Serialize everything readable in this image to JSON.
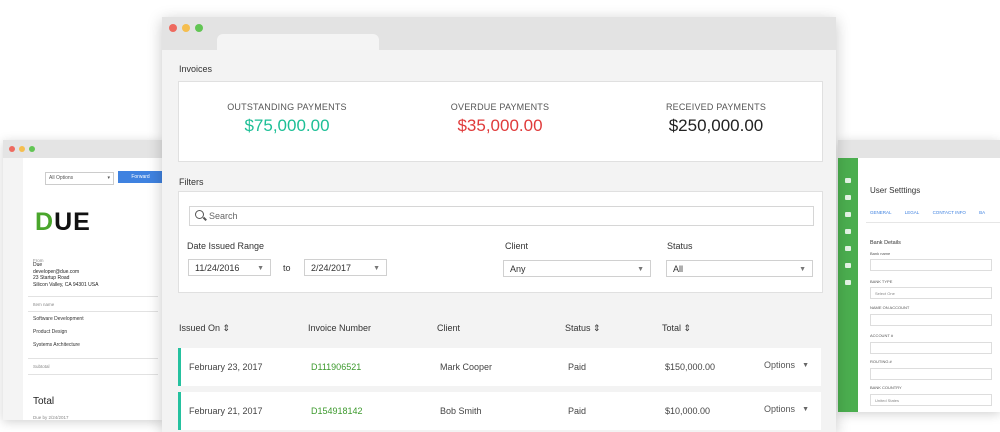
{
  "left_window": {
    "select_value": "All Options",
    "button_label": "Forward",
    "logo_text": "DUE",
    "from_label": "From",
    "company": "Due",
    "email": "developer@due.com",
    "street": "23 Startup Road",
    "city": "Silicon Valley, CA 94301 USA",
    "items_header": "Item name",
    "items": [
      "Software Development",
      "Product Design",
      "Systems Architecture"
    ],
    "subtotal_label": "Subtotal",
    "total_label": "Total",
    "due_label": "Due by 2/24/2017"
  },
  "right_window": {
    "title": "User Setttings",
    "tabs": [
      "GENERAL",
      "LEGAL",
      "CONTACT INFO",
      "BA"
    ],
    "section": "Bank Details",
    "fields": [
      {
        "label": "Bank name",
        "value": ""
      },
      {
        "label": "BANK TYPE",
        "value": "Select One"
      },
      {
        "label": "NAME ON ACCOUNT",
        "value": ""
      },
      {
        "label": "ACCOUNT #",
        "value": ""
      },
      {
        "label": "ROUTING #",
        "value": ""
      },
      {
        "label": "BANK COUNTRY",
        "value": "United States"
      }
    ]
  },
  "main": {
    "invoices_label": "Invoices",
    "summary": [
      {
        "label": "OUTSTANDING PAYMENTS",
        "value": "$75,000.00",
        "color": "#1dbf96"
      },
      {
        "label": "OVERDUE PAYMENTS",
        "value": "$35,000.00",
        "color": "#e03b3b"
      },
      {
        "label": "RECEIVED PAYMENTS",
        "value": "$250,000.00",
        "color": "#222222"
      }
    ],
    "filters_label": "Filters",
    "search_placeholder": "Search",
    "date_range_label": "Date Issued Range",
    "date_from": "11/24/2016",
    "to_label": "to",
    "date_to": "2/24/2017",
    "client_label": "Client",
    "client_value": "Any",
    "status_label": "Status",
    "status_value": "All",
    "columns": [
      "Issued On ⇕",
      "Invoice Number",
      "Client",
      "Status ⇕",
      "Total ⇕"
    ],
    "rows": [
      {
        "issued": "February 23, 2017",
        "number": "D111906521",
        "client": "Mark Cooper",
        "status": "Paid",
        "total": "$150,000.00",
        "options": "Options"
      },
      {
        "issued": "February 21, 2017",
        "number": "D154918142",
        "client": "Bob Smith",
        "status": "Paid",
        "total": "$10,000.00",
        "options": "Options"
      }
    ],
    "accent_color": "#25c19f"
  }
}
